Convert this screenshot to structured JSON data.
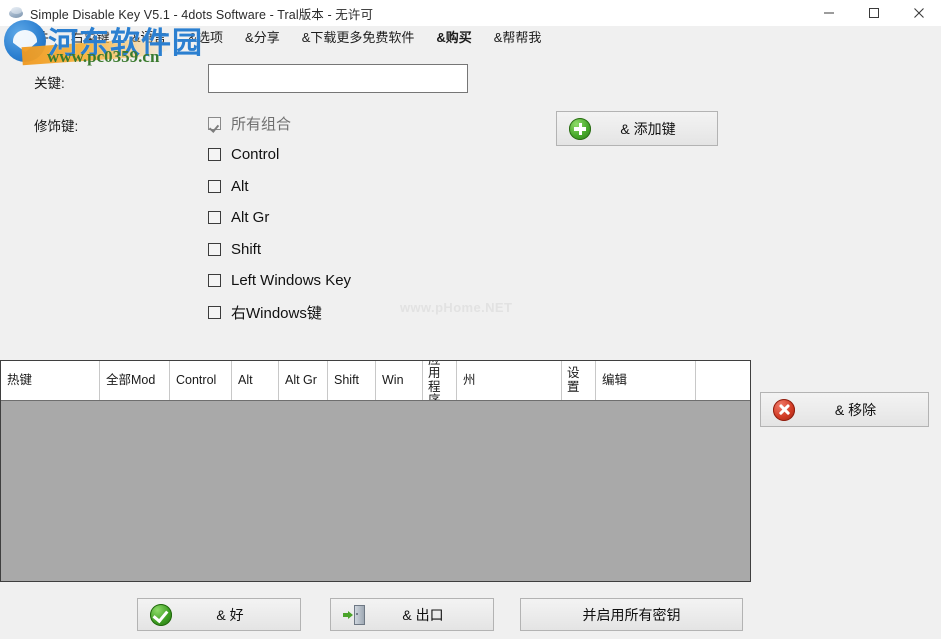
{
  "window": {
    "title": "Simple Disable Key V5.1 - 4dots Software - Tral版本 - 无许可",
    "app_icon": "disc-app-icon",
    "controls": {
      "minimize": "minimize-icon",
      "maximize": "maximize-icon",
      "close": "close-icon"
    }
  },
  "menubar": {
    "items": [
      {
        "label": "&文件",
        "bold": false
      },
      {
        "label": "右菜键",
        "bold": false
      },
      {
        "label": "&语言",
        "bold": false
      },
      {
        "label": "&选项",
        "bold": false
      },
      {
        "label": "&分享",
        "bold": false
      },
      {
        "label": "&下载更多免费软件",
        "bold": false
      },
      {
        "label": "&购买",
        "bold": true
      },
      {
        "label": "&帮帮我",
        "bold": false
      }
    ]
  },
  "watermarks": {
    "logo_text": "河东软件园",
    "url": "www.pc0359.cn",
    "faint": "www.pHome.NET"
  },
  "form": {
    "key_label": "关键:",
    "key_input_value": "",
    "key_input_placeholder": "",
    "modifier_label": "修饰键:",
    "modifiers": [
      {
        "label": "所有组合",
        "checked": true,
        "dim": true
      },
      {
        "label": "Control",
        "checked": false,
        "dim": false
      },
      {
        "label": "Alt",
        "checked": false,
        "dim": false
      },
      {
        "label": "Alt Gr",
        "checked": false,
        "dim": false
      },
      {
        "label": "Shift",
        "checked": false,
        "dim": false
      },
      {
        "label": "Left Windows Key",
        "checked": false,
        "dim": false
      },
      {
        "label": "右Windows键",
        "checked": false,
        "dim": false
      }
    ]
  },
  "buttons": {
    "add_key": {
      "label": "& 添加键",
      "icon": "green-plus-icon"
    },
    "remove": {
      "label": "& 移除",
      "icon": "red-x-icon"
    },
    "ok": {
      "label": "& 好",
      "icon": "green-check-icon"
    },
    "exit": {
      "label": "& 出口",
      "icon": "exit-door-icon"
    },
    "enable_all": {
      "label": "并启用所有密钥",
      "icon": ""
    }
  },
  "table": {
    "columns": [
      {
        "label": "热键",
        "width": 99,
        "wrap": false
      },
      {
        "label": "全部Mod",
        "width": 70,
        "wrap": false
      },
      {
        "label": "Control",
        "width": 62,
        "wrap": false
      },
      {
        "label": "Alt",
        "width": 47,
        "wrap": false
      },
      {
        "label": "Alt Gr",
        "width": 49,
        "wrap": false
      },
      {
        "label": "Shift",
        "width": 48,
        "wrap": false
      },
      {
        "label": "Win",
        "width": 47,
        "wrap": false
      },
      {
        "label": "应用程序",
        "width": 34,
        "wrap": true
      },
      {
        "label": "州",
        "width": 105,
        "wrap": false
      },
      {
        "label": "设置",
        "width": 34,
        "wrap": true
      },
      {
        "label": "编辑",
        "width": 100,
        "wrap": false
      }
    ],
    "rows": []
  },
  "colors": {
    "window_bg": "#f0f0f0",
    "titlebar_bg": "#ffffff",
    "grid_empty": "#a9a9a9",
    "accent_buy": "#1d1d1d",
    "logo_blue": "#2b7fd0",
    "url_green": "#3a7a2e"
  }
}
